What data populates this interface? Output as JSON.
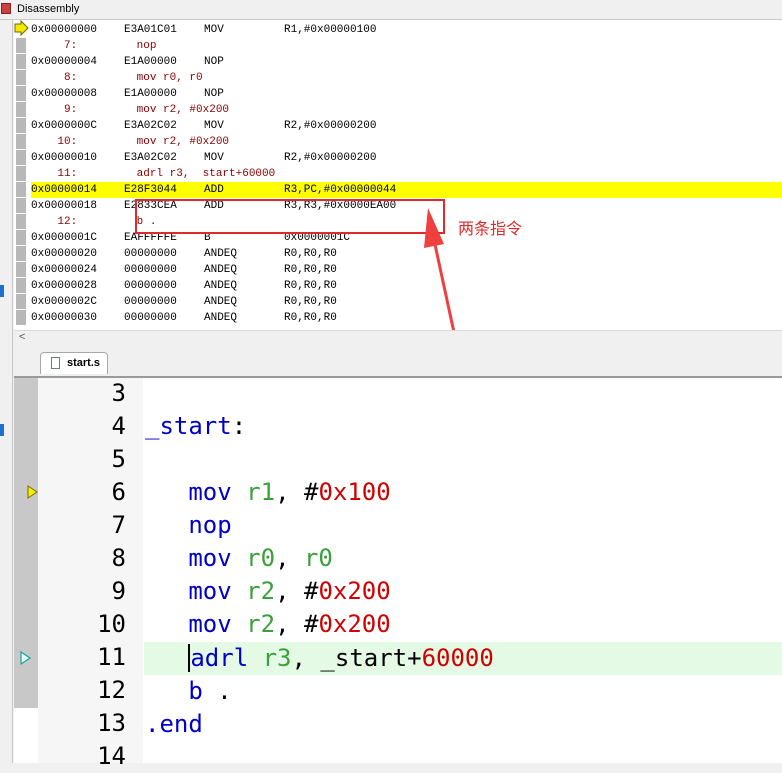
{
  "window": {
    "title": "Disassembly"
  },
  "disassembly": {
    "lines": [
      {
        "type": "asm",
        "addr": "0x00000000",
        "op": "E3A01C01",
        "mn": "MOV",
        "args": "R1,#0x00000100"
      },
      {
        "type": "src",
        "text": "     7:         nop"
      },
      {
        "type": "asm",
        "addr": "0x00000004",
        "op": "E1A00000",
        "mn": "NOP",
        "args": ""
      },
      {
        "type": "src",
        "text": "     8:         mov r0, r0"
      },
      {
        "type": "asm",
        "addr": "0x00000008",
        "op": "E1A00000",
        "mn": "NOP",
        "args": ""
      },
      {
        "type": "src",
        "text": "     9:         mov r2, #0x200"
      },
      {
        "type": "asm",
        "addr": "0x0000000C",
        "op": "E3A02C02",
        "mn": "MOV",
        "args": "R2,#0x00000200"
      },
      {
        "type": "src",
        "text": "    10:         mov r2, #0x200"
      },
      {
        "type": "asm",
        "addr": "0x00000010",
        "op": "E3A02C02",
        "mn": "MOV",
        "args": "R2,#0x00000200"
      },
      {
        "type": "src",
        "text": "    11:         adrl r3,  start+60000"
      },
      {
        "type": "asm",
        "addr": "0x00000014",
        "op": "E28F3044",
        "mn": "ADD",
        "args": "R3,PC,#0x00000044",
        "highlight": true
      },
      {
        "type": "asm",
        "addr": "0x00000018",
        "op": "E2833CEA",
        "mn": "ADD",
        "args": "R3,R3,#0x0000EA00"
      },
      {
        "type": "src",
        "text": "    12:         b ."
      },
      {
        "type": "asm",
        "addr": "0x0000001C",
        "op": "EAFFFFFE",
        "mn": "B",
        "args": "0x0000001C"
      },
      {
        "type": "asm",
        "addr": "0x00000020",
        "op": "00000000",
        "mn": "ANDEQ",
        "args": "R0,R0,R0"
      },
      {
        "type": "asm",
        "addr": "0x00000024",
        "op": "00000000",
        "mn": "ANDEQ",
        "args": "R0,R0,R0"
      },
      {
        "type": "asm",
        "addr": "0x00000028",
        "op": "00000000",
        "mn": "ANDEQ",
        "args": "R0,R0,R0"
      },
      {
        "type": "asm",
        "addr": "0x0000002C",
        "op": "00000000",
        "mn": "ANDEQ",
        "args": "R0,R0,R0"
      },
      {
        "type": "asm",
        "addr": "0x00000030",
        "op": "00000000",
        "mn": "ANDEQ",
        "args": "R0,R0,R0"
      }
    ]
  },
  "annotation": {
    "text": "两条指令",
    "color": "#e02a2a"
  },
  "scroll": {
    "left_arrow": "<"
  },
  "editor": {
    "tab_label": "start.s",
    "line_numbers": [
      "3",
      "4",
      "5",
      "6",
      "7",
      "8",
      "9",
      "10",
      "11",
      "12",
      "13",
      "14"
    ],
    "code": {
      "l4_label": "_start",
      "l4_colon": ":",
      "l6_kw": "mov",
      "l6_reg": "r1",
      "l6_sep": ", ",
      "l6_hash": "#",
      "l6_imm": "0x100",
      "l7_kw": "nop",
      "l8_kw": "mov",
      "l8_reg1": "r0",
      "l8_sep": ", ",
      "l8_reg2": "r0",
      "l9_kw": "mov",
      "l9_reg": "r2",
      "l9_sep": ", ",
      "l9_hash": "#",
      "l9_imm": "0x200",
      "l10_kw": "mov",
      "l10_reg": "r2",
      "l10_sep": ", ",
      "l10_hash": "#",
      "l10_imm": "0x200",
      "l11_kw": "adrl",
      "l11_reg": "r3",
      "l11_sep": ", ",
      "l11_label": "_start",
      "l11_plus": "+",
      "l11_imm": "60000",
      "l12_kw": "b",
      "l12_dot": " .",
      "l13_dir": ".end"
    }
  },
  "colors": {
    "highlight": "#ffff00",
    "current_line": "#e4fae4",
    "keyword": "#0000c8",
    "register": "#3aa03a",
    "immediate": "#d00000",
    "source": "#8b0000"
  }
}
